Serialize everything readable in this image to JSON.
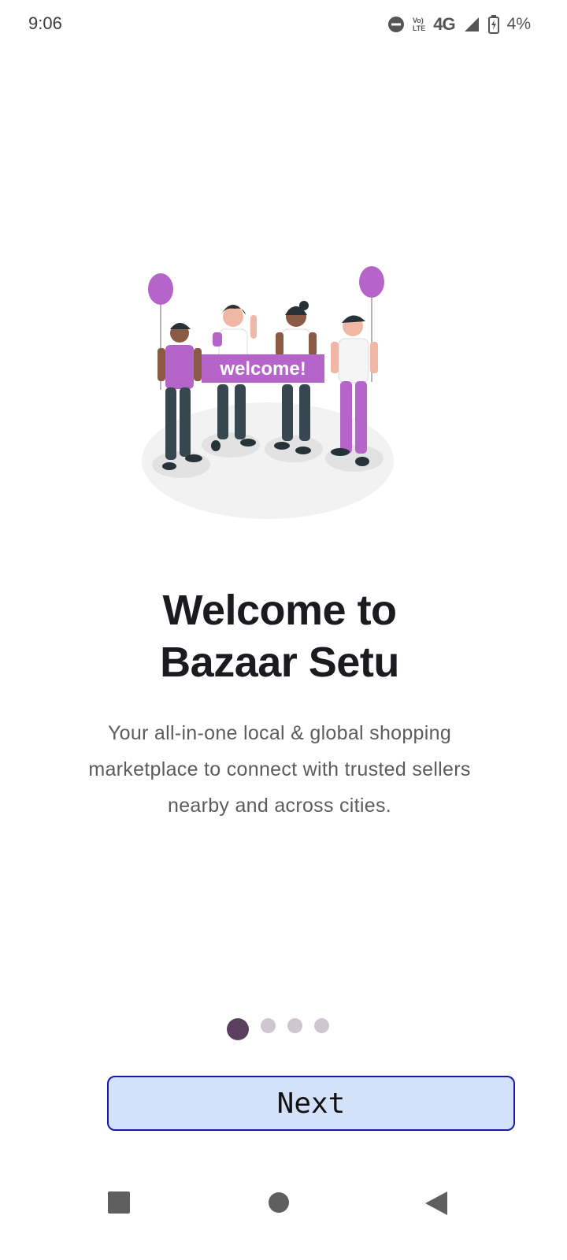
{
  "status_bar": {
    "time": "9:06",
    "lte_top": "Vo)",
    "lte_bottom": "LTE",
    "network": "4G",
    "battery": "4%",
    "icons": [
      "dnd-icon",
      "volte-icon",
      "signal-icon",
      "battery-charging-icon"
    ]
  },
  "illustration": {
    "banner_text": "welcome!",
    "accent_color": "#b565c9"
  },
  "onboarding": {
    "title_line1": "Welcome to",
    "title_line2": "Bazaar Setu",
    "subtitle": "Your all-in-one local & global shopping marketplace to connect with trusted sellers nearby and across cities.",
    "page_count": 4,
    "current_page": 1
  },
  "actions": {
    "next_label": "Next"
  },
  "nav_bar": {
    "icons": [
      "recents-icon",
      "home-icon",
      "back-icon"
    ]
  },
  "colors": {
    "active_dot": "#5b3f5f",
    "inactive_dot": "#cfc6d1",
    "button_bg": "#d3e1f9",
    "button_border": "#1a1aa6"
  }
}
